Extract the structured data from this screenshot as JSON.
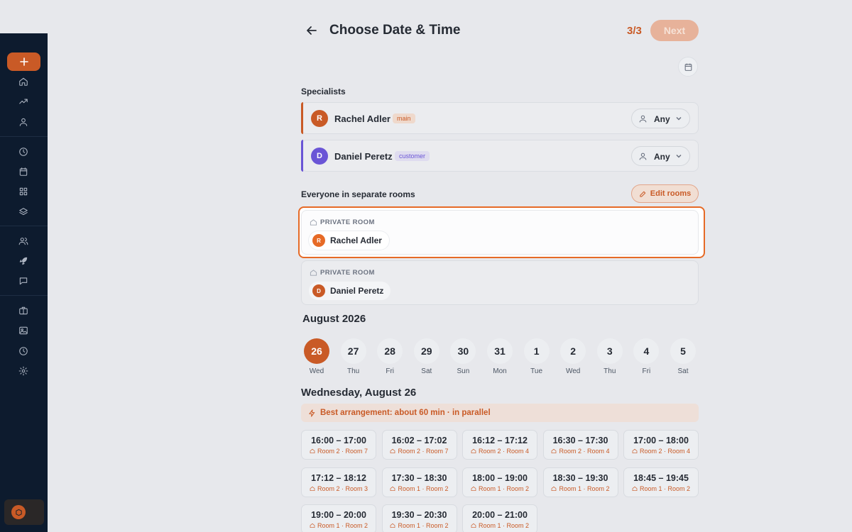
{
  "header": {
    "title": "Choose Date & Time",
    "step": "3/3",
    "next_label": "Next"
  },
  "specialists": {
    "label": "Specialists",
    "items": [
      {
        "initial": "R",
        "name": "Rachel Adler",
        "badge": "main",
        "filter": "Any",
        "color": "#c95a26"
      },
      {
        "initial": "D",
        "name": "Daniel Peretz",
        "badge": "customer",
        "filter": "Any",
        "color": "#6a55d6"
      }
    ]
  },
  "rooms": {
    "label": "Everyone in separate rooms",
    "edit_label": "Edit rooms",
    "items": [
      {
        "room_label": "PRIVATE ROOM",
        "initial": "R",
        "name": "Rachel Adler"
      },
      {
        "room_label": "PRIVATE ROOM",
        "initial": "D",
        "name": "Daniel Peretz"
      }
    ]
  },
  "calendar": {
    "month": "August 2026",
    "days": [
      {
        "n": "26",
        "w": "Wed"
      },
      {
        "n": "27",
        "w": "Thu"
      },
      {
        "n": "28",
        "w": "Fri"
      },
      {
        "n": "29",
        "w": "Sat"
      },
      {
        "n": "30",
        "w": "Sun"
      },
      {
        "n": "31",
        "w": "Mon"
      },
      {
        "n": "1",
        "w": "Tue"
      },
      {
        "n": "2",
        "w": "Wed"
      },
      {
        "n": "3",
        "w": "Thu"
      },
      {
        "n": "4",
        "w": "Fri"
      },
      {
        "n": "5",
        "w": "Sat"
      }
    ],
    "selected": "26"
  },
  "schedule": {
    "date_heading": "Wednesday, August 26",
    "best_arrangement": "Best arrangement: about 60 min · in parallel",
    "slots": [
      {
        "time": "16:00 – 17:00",
        "rooms": "Room 2 · Room 7"
      },
      {
        "time": "16:02 – 17:02",
        "rooms": "Room 2 · Room 7"
      },
      {
        "time": "16:12 – 17:12",
        "rooms": "Room 2 · Room 4"
      },
      {
        "time": "16:30 – 17:30",
        "rooms": "Room 2 · Room 4"
      },
      {
        "time": "17:00 – 18:00",
        "rooms": "Room 2 · Room 4"
      },
      {
        "time": "17:12 – 18:12",
        "rooms": "Room 2 · Room 3"
      },
      {
        "time": "17:30 – 18:30",
        "rooms": "Room 1 · Room 2"
      },
      {
        "time": "18:00 – 19:00",
        "rooms": "Room 1 · Room 2"
      },
      {
        "time": "18:30 – 19:30",
        "rooms": "Room 1 · Room 2"
      },
      {
        "time": "18:45 – 19:45",
        "rooms": "Room 1 · Room 2"
      },
      {
        "time": "19:00 – 20:00",
        "rooms": "Room 1 · Room 2"
      },
      {
        "time": "19:30 – 20:30",
        "rooms": "Room 1 · Room 2"
      },
      {
        "time": "20:00 – 21:00",
        "rooms": "Room 1 · Room 2"
      }
    ]
  },
  "sidebar": {
    "icons": [
      "plus-icon",
      "home-icon",
      "trending-icon",
      "user-icon",
      "clock-icon",
      "calendar-icon",
      "grid-icon",
      "layers-icon",
      "users-icon",
      "rocket-icon",
      "message-icon",
      "briefcase-icon",
      "image-icon",
      "history-icon",
      "settings-icon",
      "logo-icon"
    ]
  },
  "colors": {
    "accent": "#c95a26",
    "highlight_border": "#e66a26",
    "sidebar_bg": "#0d1b2e",
    "customer_avatar": "#6a55d6"
  }
}
